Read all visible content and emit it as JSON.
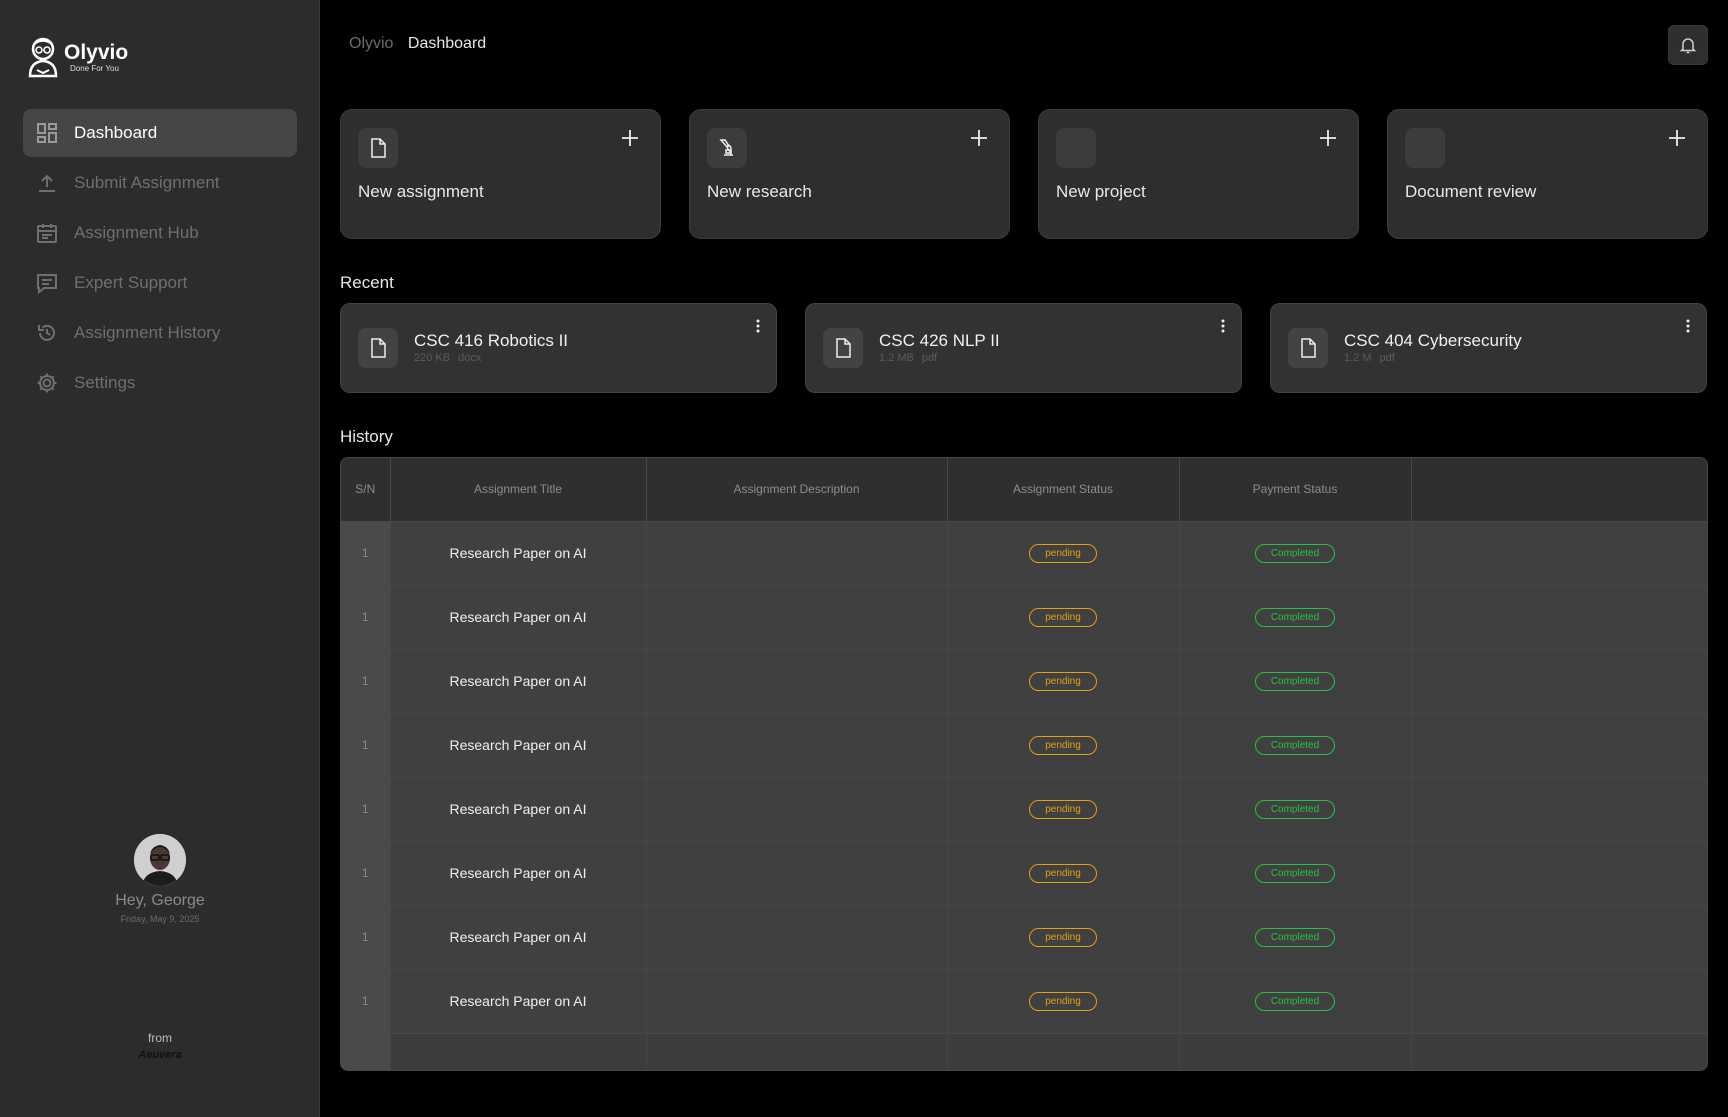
{
  "app": {
    "name": "Olyvio",
    "tagline": "Done For You"
  },
  "sidebar": {
    "items": [
      {
        "label": "Dashboard",
        "icon": "dashboard-icon",
        "active": true
      },
      {
        "label": "Submit Assignment",
        "icon": "upload-icon",
        "active": false
      },
      {
        "label": "Assignment Hub",
        "icon": "calendar-icon",
        "active": false
      },
      {
        "label": "Expert Support",
        "icon": "chat-icon",
        "active": false
      },
      {
        "label": "Assignment History",
        "icon": "history-icon",
        "active": false
      },
      {
        "label": "Settings",
        "icon": "gear-icon",
        "active": false
      }
    ],
    "profile": {
      "greeting": "Hey, George",
      "date": "Friday, May 9, 2025"
    },
    "footer": {
      "from_label": "from",
      "brand": "Aeuvera"
    }
  },
  "header": {
    "breadcrumb_root": "Olyvio",
    "breadcrumb_current": "Dashboard",
    "bell_icon": "bell-icon"
  },
  "quick_actions": [
    {
      "label": "New assignment",
      "icon": "file-icon"
    },
    {
      "label": "New research",
      "icon": "microscope-icon"
    },
    {
      "label": "New project",
      "icon": ""
    },
    {
      "label": "Document review",
      "icon": ""
    }
  ],
  "recent": {
    "title": "Recent",
    "items": [
      {
        "title": "CSC 416 Robotics II",
        "size": "220 KB",
        "type": "docx"
      },
      {
        "title": "CSC 426 NLP II",
        "size": "1.2 MB",
        "type": "pdf"
      },
      {
        "title": "CSC 404 Cybersecurity",
        "size": "1.2 M",
        "type": "pdf"
      }
    ]
  },
  "history": {
    "title": "History",
    "columns": [
      "S/N",
      "Assignment Title",
      "Assignment Description",
      "Assignment Status",
      "Payment Status",
      ""
    ],
    "rows": [
      {
        "sn": "1",
        "title": "Research Paper on AI",
        "description": "",
        "status": "pending",
        "payment": "Completed"
      },
      {
        "sn": "1",
        "title": "Research Paper on AI",
        "description": "",
        "status": "pending",
        "payment": "Completed"
      },
      {
        "sn": "1",
        "title": "Research Paper on AI",
        "description": "",
        "status": "pending",
        "payment": "Completed"
      },
      {
        "sn": "1",
        "title": "Research Paper on AI",
        "description": "",
        "status": "pending",
        "payment": "Completed"
      },
      {
        "sn": "1",
        "title": "Research Paper on AI",
        "description": "",
        "status": "pending",
        "payment": "Completed"
      },
      {
        "sn": "1",
        "title": "Research Paper on AI",
        "description": "",
        "status": "pending",
        "payment": "Completed"
      },
      {
        "sn": "1",
        "title": "Research Paper on AI",
        "description": "",
        "status": "pending",
        "payment": "Completed"
      },
      {
        "sn": "1",
        "title": "Research Paper on AI",
        "description": "",
        "status": "pending",
        "payment": "Completed"
      }
    ]
  },
  "colors": {
    "pending": "#e0a114",
    "completed": "#25c23f",
    "sidebar_bg": "#2c2c2c",
    "page_bg": "#000000"
  }
}
